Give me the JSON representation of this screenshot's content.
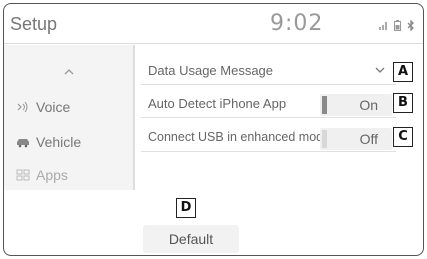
{
  "header": {
    "title": "Setup",
    "time": "9:02",
    "status_icons": [
      "signal-icon",
      "battery-icon",
      "bluetooth-icon"
    ]
  },
  "sidebar": {
    "up_icon": "chevron-up-icon",
    "items": [
      {
        "label": "Voice",
        "icon": "voice-icon"
      },
      {
        "label": "Vehicle",
        "icon": "vehicle-icon"
      },
      {
        "label": "Apps",
        "icon": "apps-icon"
      }
    ]
  },
  "settings": [
    {
      "label": "Data Usage Message",
      "control": "dropdown",
      "badge": "A"
    },
    {
      "label": "Auto Detect iPhone App",
      "control": "toggle",
      "value": "On",
      "badge": "B"
    },
    {
      "label": "Connect USB in enhanced mode.",
      "control": "toggle",
      "value": "Off",
      "badge": "C"
    }
  ],
  "default_button": {
    "label": "Default",
    "badge": "D"
  },
  "colors": {
    "toggle_on": "#8a8a8a",
    "toggle_off": "#d8d8d8"
  }
}
